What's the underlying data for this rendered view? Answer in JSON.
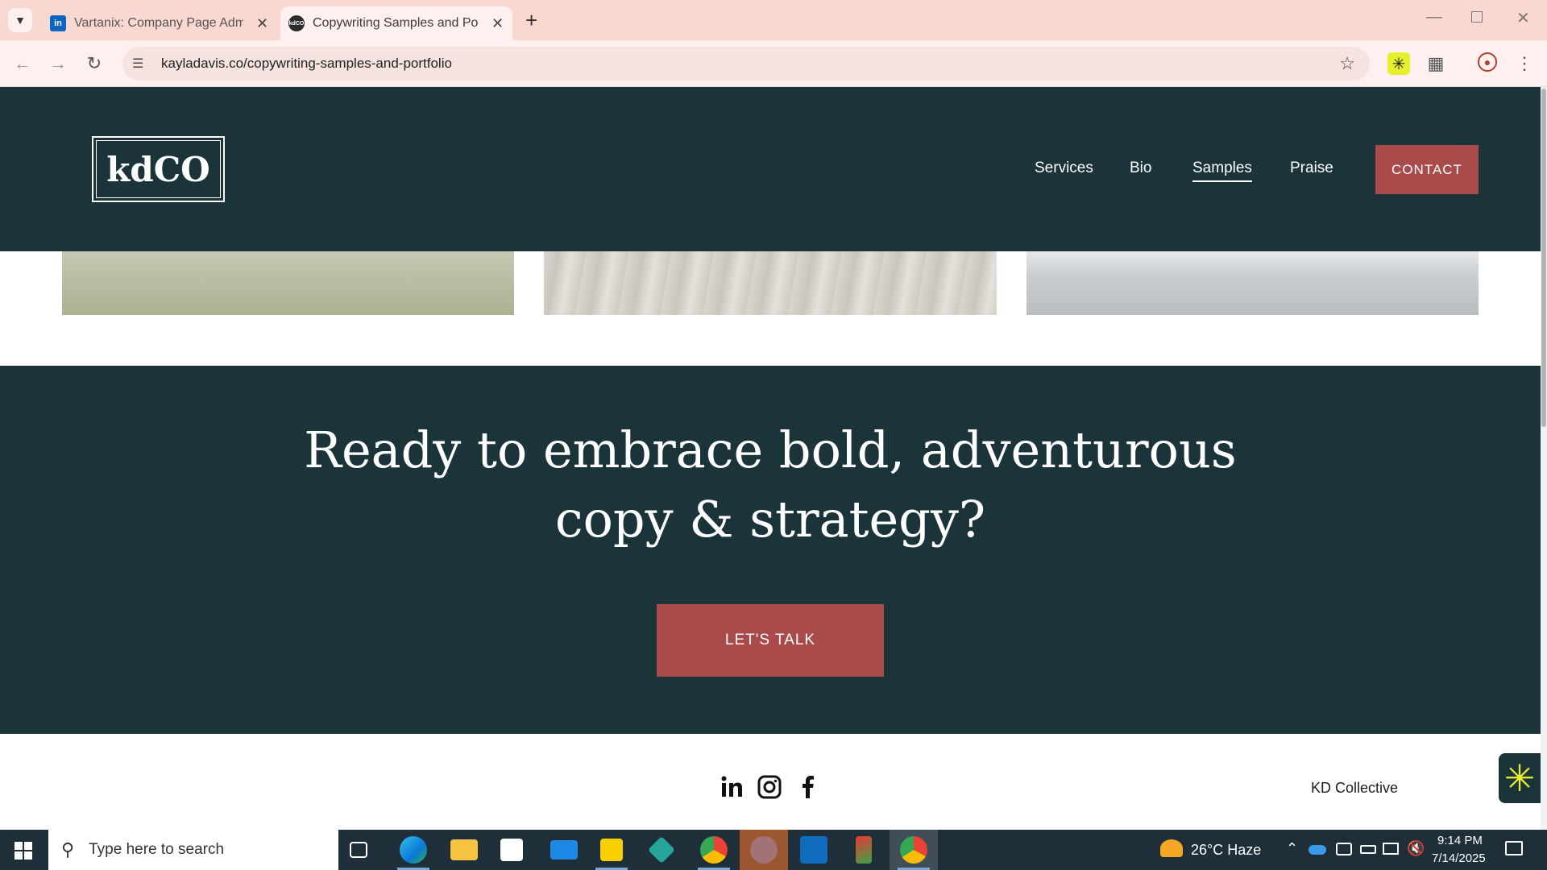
{
  "browser": {
    "tabs": [
      {
        "title": "Vartanix: Company Page Admin",
        "favicon": "linkedin-icon",
        "active": false
      },
      {
        "title": "Copywriting Samples and Portfolio",
        "favicon": "kdco-icon",
        "active": true
      }
    ],
    "url": "kayladavis.co/copywriting-samples-and-portfolio"
  },
  "site": {
    "logo": "kdCO",
    "nav": [
      "Services",
      "Bio",
      "Samples",
      "Praise"
    ],
    "contact_label": "CONTACT",
    "cta_heading_line1": "Ready to embrace bold, adventurous",
    "cta_heading_line2": "copy & strategy?",
    "cta_button": "LET'S TALK",
    "footer_brand": "KD Collective",
    "social": [
      "linkedin-icon",
      "instagram-icon",
      "facebook-icon"
    ]
  },
  "taskbar": {
    "search_placeholder": "Type here to search",
    "weather": "26°C  Haze",
    "time": "9:14 PM",
    "date": "7/14/2025"
  },
  "colors": {
    "site_dark": "#1b3439",
    "accent": "#a94a4b",
    "tabbar": "#f9d8d1"
  }
}
